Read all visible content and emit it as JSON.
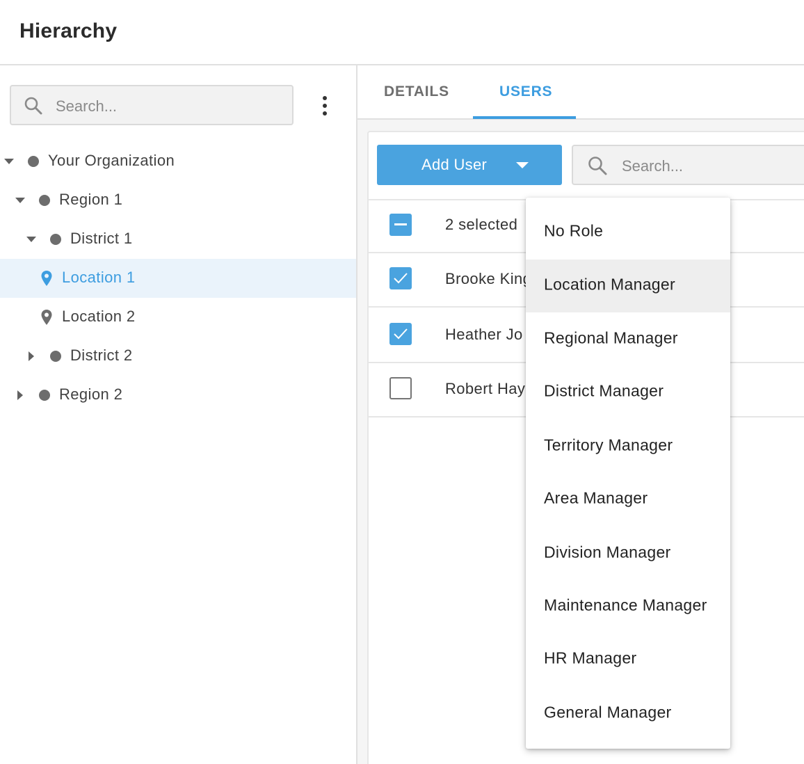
{
  "header": {
    "title": "Hierarchy"
  },
  "sidebar": {
    "search_placeholder": "Search...",
    "tree": [
      {
        "label": "Your Organization",
        "kind": "node",
        "expanded": true,
        "level": 0
      },
      {
        "label": "Region 1",
        "kind": "node",
        "expanded": true,
        "level": 1
      },
      {
        "label": "District 1",
        "kind": "node",
        "expanded": true,
        "level": 2
      },
      {
        "label": "Location 1",
        "kind": "location",
        "selected": true,
        "level": 3
      },
      {
        "label": "Location 2",
        "kind": "location",
        "selected": false,
        "level": 3
      },
      {
        "label": "District 2",
        "kind": "node",
        "expanded": false,
        "level": 2
      },
      {
        "label": "Region 2",
        "kind": "node",
        "expanded": false,
        "level": 1
      }
    ]
  },
  "tabs": {
    "details": "DETAILS",
    "users": "USERS",
    "active": "USERS"
  },
  "toolbar": {
    "add_user_label": "Add User",
    "search_placeholder": "Search..."
  },
  "users": {
    "selected_summary": "2 selected",
    "rows": [
      {
        "name": "Brooke King",
        "checked": true
      },
      {
        "name": "Heather Jo",
        "checked": true
      },
      {
        "name": "Robert Hay",
        "checked": false
      }
    ]
  },
  "role_menu": {
    "items": [
      "No Role",
      "Location Manager",
      "Regional Manager",
      "District Manager",
      "Territory Manager",
      "Area Manager",
      "Division Manager",
      "Maintenance Manager",
      "HR Manager",
      "General Manager"
    ],
    "highlighted": "Location Manager"
  },
  "colors": {
    "accent": "#4aa3df",
    "selected_row_bg": "#eaf3fb",
    "menu_hover": "#eeeeee"
  }
}
